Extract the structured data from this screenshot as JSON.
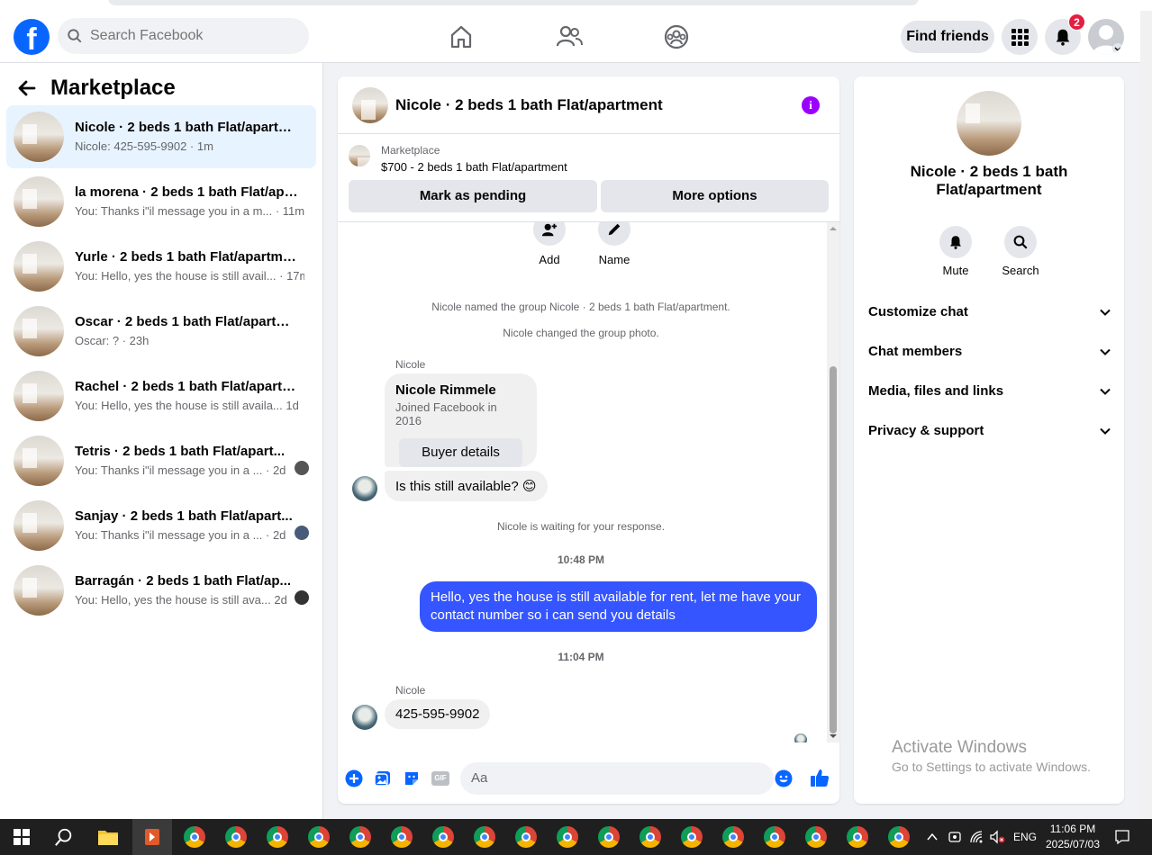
{
  "header": {
    "search_placeholder": "Search Facebook",
    "find_friends": "Find friends",
    "notification_count": "2"
  },
  "sidebar": {
    "title": "Marketplace",
    "conversations": [
      {
        "title": "Nicole · 2 beds 1 bath Flat/apartm...",
        "sub": "Nicole: 425-595-9902 · 1m",
        "active": true
      },
      {
        "title": "la morena · 2 beds 1 bath Flat/apar...",
        "sub": "You: Thanks i\"il message you in a m... · 11m"
      },
      {
        "title": "Yurle · 2 beds 1 bath Flat/apartment",
        "sub": "You: Hello, yes the house is still avail... · 17m"
      },
      {
        "title": "Oscar · 2 beds 1 bath Flat/apartment",
        "sub": "Oscar: ? · 23h"
      },
      {
        "title": "Rachel · 2 beds 1 bath Flat/apartm...",
        "sub": "You: Hello, yes the house is still availa...   1d"
      },
      {
        "title": "Tetris · 2 beds 1 bath Flat/apart...",
        "sub": "You: Thanks i\"il message you in a ...   · 2d"
      },
      {
        "title": "Sanjay · 2 beds 1 bath Flat/apart...",
        "sub": "You: Thanks i\"il message you in a ...   · 2d"
      },
      {
        "title": "Barragán · 2 beds 1 bath Flat/ap...",
        "sub": "You: Hello, yes the house is still ava...   2d"
      }
    ]
  },
  "chat": {
    "title": "Nicole · 2 beds 1 bath Flat/apartment",
    "listing_label": "Marketplace",
    "listing_price": "$700 - 2 beds 1 bath Flat/apartment",
    "mark_pending": "Mark as pending",
    "more_options": "More options",
    "add_label": "Add",
    "name_label": "Name",
    "sys1": "Nicole named the group Nicole · 2 beds 1 bath Flat/apartment.",
    "sys2": "Nicole changed the group photo.",
    "sender1": "Nicole",
    "card_name": "Nicole Rimmele",
    "card_sub": "Joined Facebook in 2016",
    "buyer_details": "Buyer details",
    "msg1": "Is this still available? 😊",
    "waiting": "Nicole is waiting for your response.",
    "time1": "10:48 PM",
    "msg_mine": "Hello, yes the house is still available for rent, let me have your contact number so i can send you details",
    "time2": "11:04 PM",
    "sender2": "Nicole",
    "msg2": "425-595-9902",
    "composer_placeholder": "Aa",
    "gif": "GIF"
  },
  "details": {
    "title": "Nicole · 2 beds 1 bath Flat/apartment",
    "mute": "Mute",
    "search": "Search",
    "rows": [
      "Customize chat",
      "Chat members",
      "Media, files and links",
      "Privacy & support"
    ]
  },
  "watermark": {
    "line1": "Activate Windows",
    "line2": "Go to Settings to activate Windows."
  },
  "taskbar": {
    "lang": "ENG",
    "time": "11:06 PM",
    "date": "2025/07/03"
  }
}
